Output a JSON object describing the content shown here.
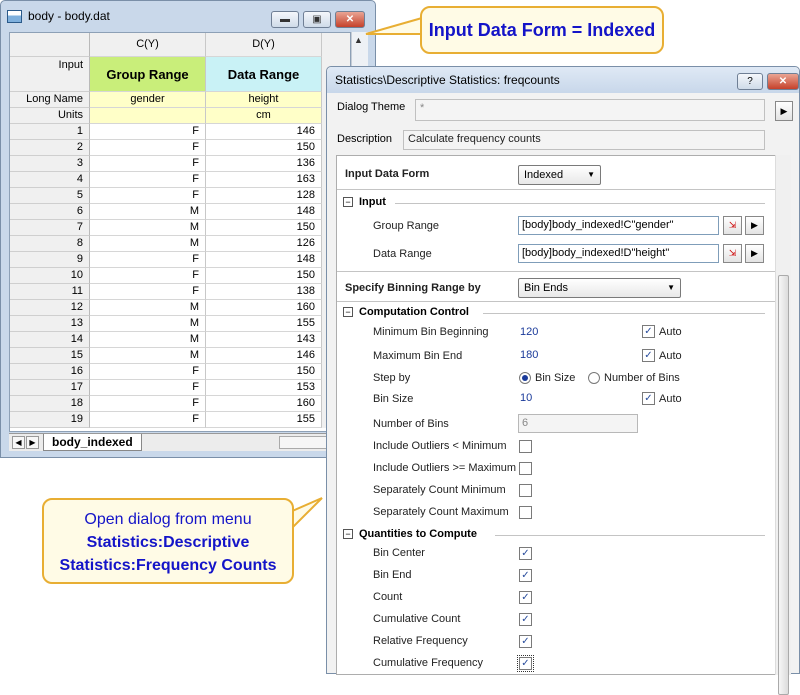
{
  "worksheet": {
    "title": "body - body.dat",
    "col_c": "C(Y)",
    "col_d": "D(Y)",
    "row_input_label": "Input",
    "input_c": "Group Range",
    "input_d": "Data Range",
    "row_longname_label": "Long Name",
    "longname_c": "gender",
    "longname_d": "height",
    "row_units_label": "Units",
    "units_d": "cm",
    "rows": [
      {
        "n": "1",
        "g": "F",
        "h": "146"
      },
      {
        "n": "2",
        "g": "F",
        "h": "150"
      },
      {
        "n": "3",
        "g": "F",
        "h": "136"
      },
      {
        "n": "4",
        "g": "F",
        "h": "163"
      },
      {
        "n": "5",
        "g": "F",
        "h": "128"
      },
      {
        "n": "6",
        "g": "M",
        "h": "148"
      },
      {
        "n": "7",
        "g": "M",
        "h": "150"
      },
      {
        "n": "8",
        "g": "M",
        "h": "126"
      },
      {
        "n": "9",
        "g": "F",
        "h": "148"
      },
      {
        "n": "10",
        "g": "F",
        "h": "150"
      },
      {
        "n": "11",
        "g": "F",
        "h": "138"
      },
      {
        "n": "12",
        "g": "M",
        "h": "160"
      },
      {
        "n": "13",
        "g": "M",
        "h": "155"
      },
      {
        "n": "14",
        "g": "M",
        "h": "143"
      },
      {
        "n": "15",
        "g": "M",
        "h": "146"
      },
      {
        "n": "16",
        "g": "F",
        "h": "150"
      },
      {
        "n": "17",
        "g": "F",
        "h": "153"
      },
      {
        "n": "18",
        "g": "F",
        "h": "160"
      },
      {
        "n": "19",
        "g": "F",
        "h": "155"
      }
    ],
    "sheet_tab": "body_indexed"
  },
  "callouts": {
    "top": "Input Data Form = Indexed",
    "bottom_line1": "Open dialog from menu",
    "bottom_line2": "Statistics:Descriptive",
    "bottom_line3": "Statistics:Frequency Counts"
  },
  "dialog": {
    "title": "Statistics\\Descriptive Statistics: freqcounts",
    "help_btn": "?",
    "theme_label": "Dialog Theme",
    "theme_value": "*",
    "description_label": "Description",
    "description_value": "Calculate frequency counts",
    "input_data_form_label": "Input Data Form",
    "input_data_form_value": "Indexed",
    "section_input": "Input",
    "group_range_label": "Group Range",
    "group_range_value": "[body]body_indexed!C\"gender\"",
    "data_range_label": "Data Range",
    "data_range_value": "[body]body_indexed!D\"height\"",
    "binning_label": "Specify Binning Range by",
    "binning_value": "Bin Ends",
    "section_computation": "Computation Control",
    "min_bin_label": "Minimum Bin Beginning",
    "min_bin_value": "120",
    "max_bin_label": "Maximum Bin End",
    "max_bin_value": "180",
    "auto_label": "Auto",
    "step_by_label": "Step by",
    "step_bin_size": "Bin Size",
    "step_num_bins": "Number of Bins",
    "bin_size_label": "Bin Size",
    "bin_size_value": "10",
    "num_bins_label": "Number of Bins",
    "num_bins_value": "6",
    "outliers_min_label": "Include Outliers < Minimum",
    "outliers_max_label": "Include Outliers >= Maximum",
    "sep_min_label": "Separately Count Minimum",
    "sep_max_label": "Separately Count Maximum",
    "section_quantities": "Quantities to Compute",
    "q_bin_center": "Bin Center",
    "q_bin_end": "Bin End",
    "q_count": "Count",
    "q_cum_count": "Cumulative Count",
    "q_rel_freq": "Relative Frequency",
    "q_cum_freq": "Cumulative Frequency"
  }
}
